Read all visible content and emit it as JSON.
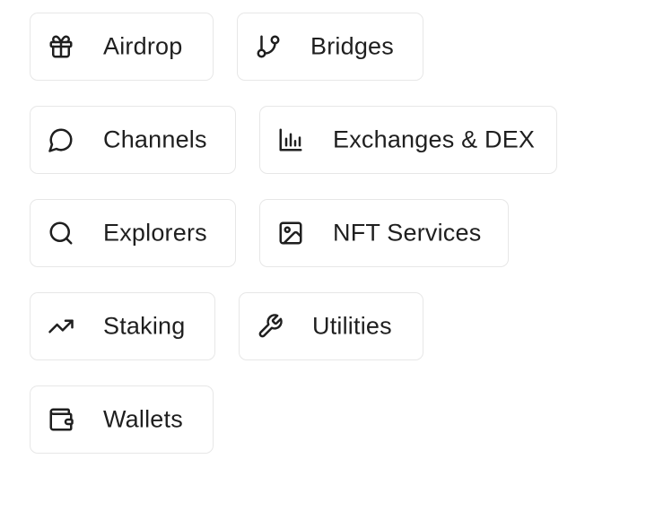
{
  "categories": [
    {
      "label": "Airdrop",
      "icon": "gift-icon"
    },
    {
      "label": "Bridges",
      "icon": "git-branch-icon"
    },
    {
      "label": "Channels",
      "icon": "message-circle-icon"
    },
    {
      "label": "Exchanges & DEX",
      "icon": "bar-chart-icon"
    },
    {
      "label": "Explorers",
      "icon": "search-icon"
    },
    {
      "label": "NFT Services",
      "icon": "image-icon"
    },
    {
      "label": "Staking",
      "icon": "trending-up-icon"
    },
    {
      "label": "Utilities",
      "icon": "wrench-icon"
    },
    {
      "label": "Wallets",
      "icon": "wallet-icon"
    }
  ]
}
